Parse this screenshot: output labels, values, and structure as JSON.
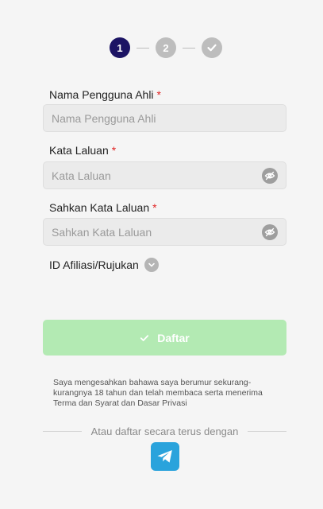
{
  "stepper": {
    "steps": [
      {
        "label": "1",
        "state": "active"
      },
      {
        "label": "2",
        "state": "pending"
      },
      {
        "icon": "check-icon",
        "state": "pending"
      }
    ],
    "active_color": "#1c1464",
    "inactive_color": "#bdbdbd"
  },
  "form": {
    "username": {
      "label": "Nama Pengguna Ahli",
      "required_mark": "*",
      "placeholder": "Nama Pengguna Ahli",
      "value": ""
    },
    "password": {
      "label": "Kata Laluan",
      "required_mark": "*",
      "placeholder": "Kata Laluan",
      "value": "",
      "toggle_icon": "eye-off-icon"
    },
    "confirm_password": {
      "label": "Sahkan Kata Laluan",
      "required_mark": "*",
      "placeholder": "Sahkan Kata Laluan",
      "value": "",
      "toggle_icon": "eye-off-icon"
    },
    "referral": {
      "label": "ID Afiliasi/Rujukan",
      "toggle_icon": "chevron-down-icon"
    }
  },
  "submit": {
    "label": "Daftar",
    "icon": "check-icon",
    "color": "#b3eab3"
  },
  "terms_text": "Saya mengesahkan bahawa saya berumur sekurang-kurangnya 18 tahun dan telah membaca serta menerima Terma dan Syarat dan Dasar Privasi",
  "alt_register": {
    "text": "Atau daftar secara terus dengan",
    "providers": [
      {
        "icon": "telegram-icon",
        "color": "#2aa3dc"
      }
    ]
  }
}
